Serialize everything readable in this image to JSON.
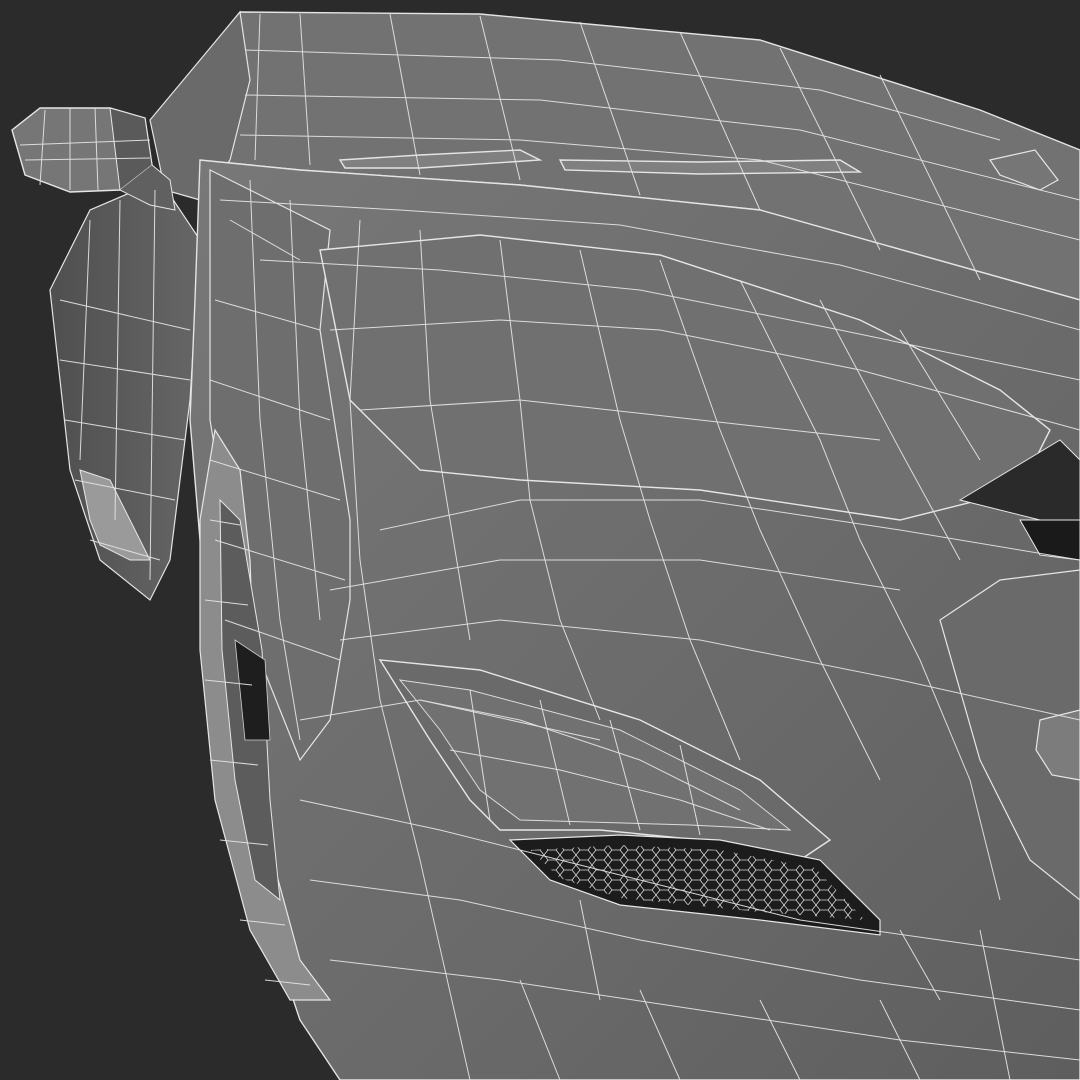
{
  "scene": {
    "subject": "sports-car-front-wireframe",
    "colors": {
      "background": "#2b2b2b",
      "surface": "#6c6c6c",
      "surface_light": "#7a7a7a",
      "surface_dark": "#585858",
      "cavity": "#1c1c1c",
      "wire": "#e4e4e4",
      "tire": "#8a8a8a"
    }
  }
}
